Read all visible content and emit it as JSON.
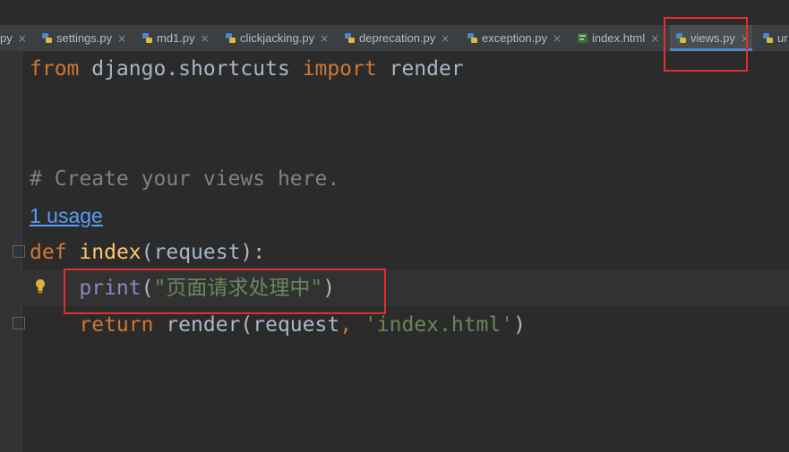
{
  "tabs": [
    {
      "label": "py",
      "close": "×",
      "type": "python"
    },
    {
      "label": "settings.py",
      "close": "×",
      "type": "python"
    },
    {
      "label": "md1.py",
      "close": "×",
      "type": "python"
    },
    {
      "label": "clickjacking.py",
      "close": "×",
      "type": "python"
    },
    {
      "label": "deprecation.py",
      "close": "×",
      "type": "python"
    },
    {
      "label": "exception.py",
      "close": "×",
      "type": "python"
    },
    {
      "label": "index.html",
      "close": "×",
      "type": "html"
    },
    {
      "label": "views.py",
      "close": "×",
      "type": "python",
      "active": true
    },
    {
      "label": "ur",
      "close": "",
      "type": "python"
    }
  ],
  "code": {
    "line1": {
      "kw1": "from",
      "mod": " django.shortcuts ",
      "kw2": "import",
      "name": " render"
    },
    "comment": "# Create your views here.",
    "usage_hint": "1 usage",
    "def_line": {
      "kw": "def",
      "space": " ",
      "fn": "index",
      "rest": "(request):"
    },
    "print_line": {
      "indent": "    ",
      "builtin": "print",
      "open": "(",
      "str": "\"页面请求处理中\"",
      "close": ")"
    },
    "return_line": {
      "indent": "    ",
      "kw": "return",
      "mid": " render(request",
      "comma": ",",
      "space": " ",
      "str": "'index.html'",
      "close": ")"
    }
  },
  "colors": {
    "background": "#2b2b2b",
    "keyword": "#cc7832",
    "comment": "#808080",
    "string": "#6a8759",
    "function": "#ffc66d",
    "builtin": "#8888c6",
    "link": "#589df6",
    "highlight_box": "#e02f2f"
  },
  "icons": {
    "python_file": "python-file-icon",
    "html_file": "html-file-icon",
    "intention_bulb": "lightbulb-icon"
  }
}
